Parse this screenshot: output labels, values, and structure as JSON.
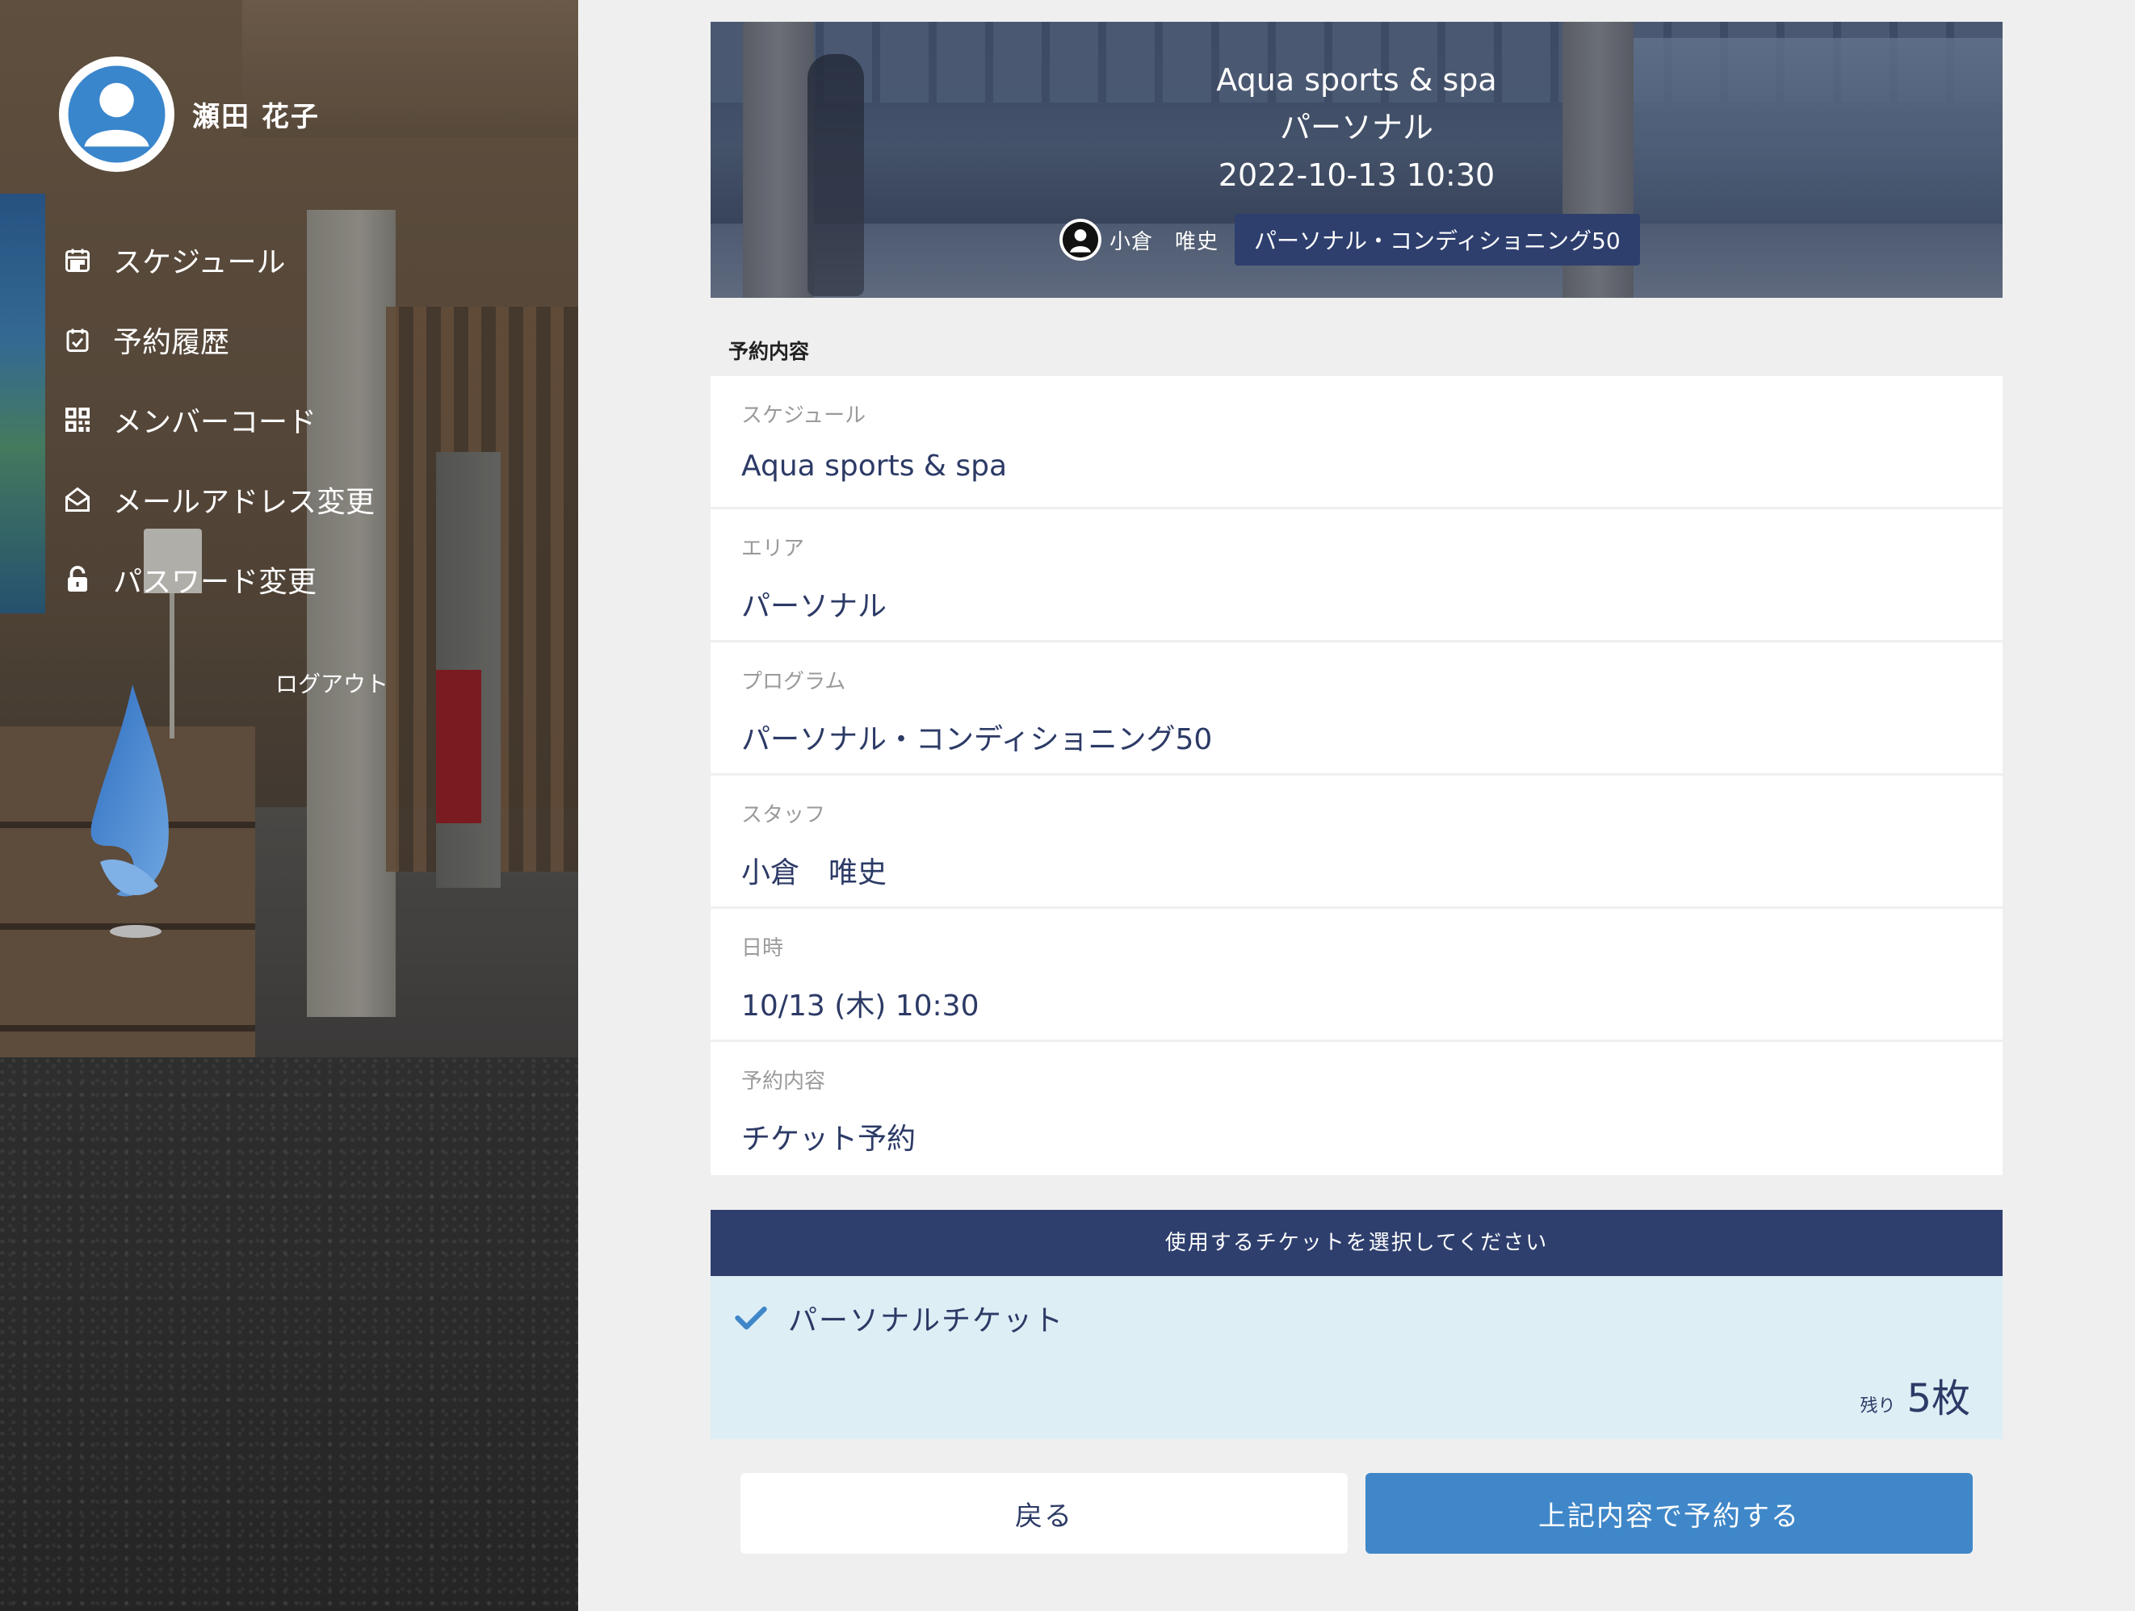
{
  "sidebar": {
    "user_name": "瀬田 花子",
    "menu": [
      {
        "label": "スケジュール",
        "icon": "calendar-icon"
      },
      {
        "label": "予約履歴",
        "icon": "calendar-check-icon"
      },
      {
        "label": "メンバーコード",
        "icon": "qr-code-icon"
      },
      {
        "label": "メールアドレス変更",
        "icon": "envelope-open-icon"
      },
      {
        "label": "パスワード変更",
        "icon": "unlock-icon"
      }
    ],
    "logout_label": "ログアウト"
  },
  "hero": {
    "title": "Aqua sports & spa",
    "subtitle": "パーソナル",
    "datetime": "2022-10-13 10:30",
    "staff": "小倉　唯史",
    "program": "パーソナル・コンディショニング50"
  },
  "reservation": {
    "section_label": "予約内容",
    "rows": [
      {
        "label": "スケジュール",
        "value": "Aqua sports & spa"
      },
      {
        "label": "エリア",
        "value": "パーソナル"
      },
      {
        "label": "プログラム",
        "value": "パーソナル・コンディショニング50"
      },
      {
        "label": "スタッフ",
        "value": "小倉　唯史"
      },
      {
        "label": "日時",
        "value": "10/13 (木) 10:30"
      },
      {
        "label": "予約内容",
        "value": "チケット予約"
      }
    ]
  },
  "ticket": {
    "header": "使用するチケットを選択してください",
    "name": "パーソナルチケット",
    "remaining_label": "残り",
    "remaining_value": "5枚"
  },
  "buttons": {
    "back": "戻る",
    "reserve": "上記内容で予約する"
  },
  "colors": {
    "navy": "#2e3f6e",
    "text_navy": "#2c3a66",
    "accent_blue": "#3f87c8",
    "ticket_bg": "#ddeef5"
  }
}
